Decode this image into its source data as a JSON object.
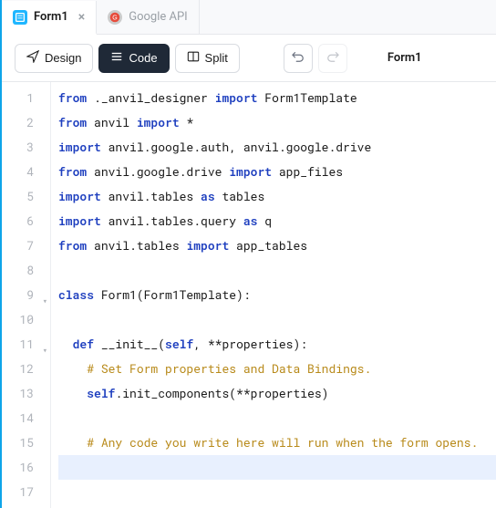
{
  "tabs": [
    {
      "label": "Form1",
      "icon": "form",
      "active": true,
      "closeable": true
    },
    {
      "label": "Google API",
      "icon": "google",
      "active": false,
      "closeable": false
    }
  ],
  "toolbar": {
    "design": "Design",
    "code": "Code",
    "split": "Split"
  },
  "breadcrumb": "Form1",
  "code": {
    "lines": [
      {
        "n": 1,
        "fold": "",
        "tokens": [
          [
            "kw",
            "from"
          ],
          [
            "mod",
            " ._anvil_designer "
          ],
          [
            "kw",
            "import"
          ],
          [
            "mod",
            " Form1Template"
          ]
        ]
      },
      {
        "n": 2,
        "fold": "",
        "tokens": [
          [
            "kw",
            "from"
          ],
          [
            "mod",
            " anvil "
          ],
          [
            "kw",
            "import"
          ],
          [
            "op",
            " *"
          ]
        ]
      },
      {
        "n": 3,
        "fold": "",
        "tokens": [
          [
            "kw",
            "import"
          ],
          [
            "mod",
            " anvil.google.auth, anvil.google.drive"
          ]
        ]
      },
      {
        "n": 4,
        "fold": "",
        "tokens": [
          [
            "kw",
            "from"
          ],
          [
            "mod",
            " anvil.google.drive "
          ],
          [
            "kw",
            "import"
          ],
          [
            "mod",
            " app_files"
          ]
        ]
      },
      {
        "n": 5,
        "fold": "",
        "tokens": [
          [
            "kw",
            "import"
          ],
          [
            "mod",
            " anvil.tables "
          ],
          [
            "kw",
            "as"
          ],
          [
            "mod",
            " tables"
          ]
        ]
      },
      {
        "n": 6,
        "fold": "",
        "tokens": [
          [
            "kw",
            "import"
          ],
          [
            "mod",
            " anvil.tables.query "
          ],
          [
            "kw",
            "as"
          ],
          [
            "mod",
            " q"
          ]
        ]
      },
      {
        "n": 7,
        "fold": "",
        "tokens": [
          [
            "kw",
            "from"
          ],
          [
            "mod",
            " anvil.tables "
          ],
          [
            "kw",
            "import"
          ],
          [
            "mod",
            " app_tables"
          ]
        ]
      },
      {
        "n": 8,
        "fold": "",
        "tokens": []
      },
      {
        "n": 9,
        "fold": "▾",
        "tokens": [
          [
            "kw",
            "class"
          ],
          [
            "mod",
            " Form1(Form1Template):"
          ]
        ]
      },
      {
        "n": 10,
        "fold": "",
        "tokens": []
      },
      {
        "n": 11,
        "fold": "▾",
        "tokens": [
          [
            "mod",
            "  "
          ],
          [
            "kw",
            "def"
          ],
          [
            "mod",
            " __init__"
          ],
          [
            "punc",
            "("
          ],
          [
            "kw",
            "self"
          ],
          [
            "punc",
            ", **properties):"
          ]
        ]
      },
      {
        "n": 12,
        "fold": "",
        "tokens": [
          [
            "mod",
            "    "
          ],
          [
            "com",
            "# Set Form properties and Data Bindings."
          ]
        ]
      },
      {
        "n": 13,
        "fold": "",
        "tokens": [
          [
            "mod",
            "    "
          ],
          [
            "kw",
            "self"
          ],
          [
            "mod",
            ".init_components(**properties)"
          ]
        ]
      },
      {
        "n": 14,
        "fold": "",
        "tokens": []
      },
      {
        "n": 15,
        "fold": "",
        "tokens": [
          [
            "mod",
            "    "
          ],
          [
            "com",
            "# Any code you write here will run when the form opens."
          ]
        ]
      },
      {
        "n": 16,
        "fold": "",
        "hl": true,
        "tokens": [
          [
            "mod",
            "    "
          ]
        ]
      },
      {
        "n": 17,
        "fold": "",
        "tokens": []
      }
    ]
  }
}
